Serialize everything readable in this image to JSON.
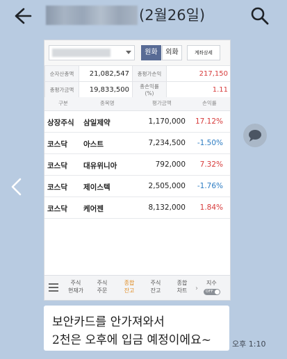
{
  "header": {
    "title_date": "(2월26일)"
  },
  "photo": {
    "controls": {
      "won_label": "원화",
      "fx_label": "외화",
      "detail_label": "계좌상세"
    },
    "summary": [
      {
        "label": "순자산총액",
        "value": "21,082,547",
        "label2": "총평가손익",
        "value2": "217,150"
      },
      {
        "label": "총평가금액",
        "value": "19,833,500",
        "label2": "총손익률(%)",
        "value2": "1.11"
      }
    ],
    "table": {
      "headers": [
        "구분",
        "종목명",
        "평가금액",
        "손익률"
      ],
      "rows": [
        {
          "type": "상장주식",
          "name": "삼일제약",
          "value": "1,170,000",
          "rate": "17.12%",
          "dir": "up"
        },
        {
          "type": "코스닥",
          "name": "아스트",
          "value": "7,234,500",
          "rate": "-1.50%",
          "dir": "down"
        },
        {
          "type": "코스닥",
          "name": "대유위니아",
          "value": "792,000",
          "rate": "7.32%",
          "dir": "up"
        },
        {
          "type": "코스닥",
          "name": "제이스텍",
          "value": "2,505,000",
          "rate": "-1.76%",
          "dir": "down"
        },
        {
          "type": "코스닥",
          "name": "케어젠",
          "value": "8,132,000",
          "rate": "1.84%",
          "dir": "up"
        }
      ]
    },
    "bottom_tabs": [
      {
        "l1": "주식",
        "l2": "현재가"
      },
      {
        "l1": "주식",
        "l2": "주문"
      },
      {
        "l1": "종합",
        "l2": "잔고"
      },
      {
        "l1": "주식",
        "l2": "잔고"
      },
      {
        "l1": "종합",
        "l2": "차트"
      }
    ],
    "index_label": "지수",
    "toggle_label": "OFF"
  },
  "message": {
    "line1": "보안카드를 안가져와서",
    "line2": "2천은 오후에 입금 예정이에요~",
    "time": "오후 1:10"
  },
  "colors": {
    "background": "#b8cbe1",
    "up": "#d73a3a",
    "down": "#2b7bc2",
    "active_tab": "#e08a1e",
    "won_button": "#586b95"
  }
}
